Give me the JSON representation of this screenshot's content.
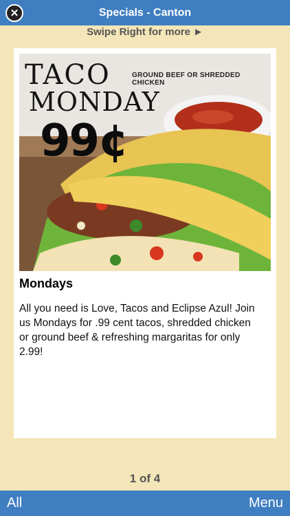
{
  "header": {
    "title": "Specials - Canton",
    "close_icon": "close-icon"
  },
  "hint": "Swipe Right for more ►",
  "special": {
    "image": {
      "line1": "TACO",
      "line2": "MONDAY",
      "price": "99¢",
      "subtitle": "GROUND BEEF OR SHREDDED CHICKEN"
    },
    "title": "Mondays",
    "description": "All you need is Love, Tacos and Eclipse Azul! Join us Mondays for .99 cent tacos, shredded chicken or ground beef & refreshing margaritas for only 2.99!"
  },
  "pager": "1 of 4",
  "footer": {
    "left_label": "All",
    "right_label": "Menu"
  },
  "colors": {
    "bar": "#3f7ec1",
    "background": "#f4e6b8"
  }
}
